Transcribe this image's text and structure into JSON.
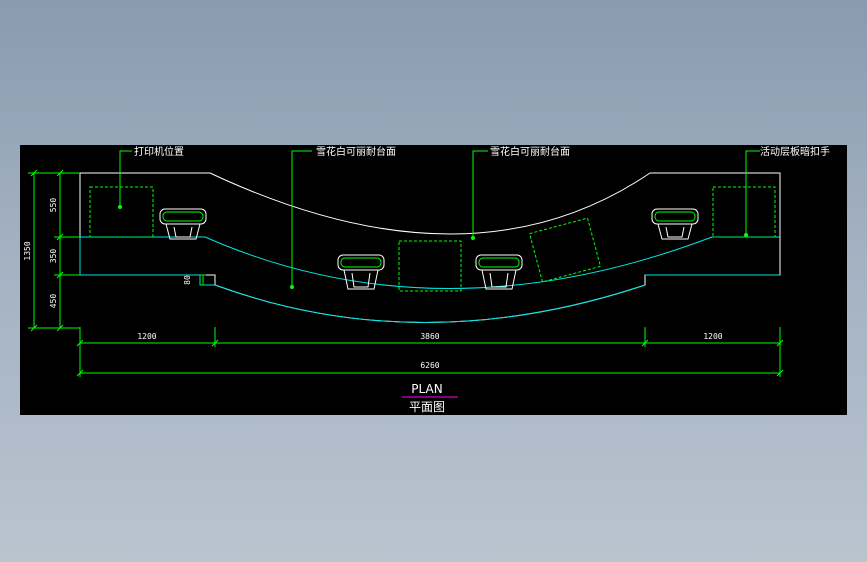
{
  "colors": {
    "background": "#000000",
    "outline": "#ffffff",
    "counter_edge": "#00e5e5",
    "annotation": "#00ff00",
    "title_underline": "#ff00ff"
  },
  "callouts": {
    "printer_position": "打印机位置",
    "marble_top_1": "雪花白可丽耐台面",
    "marble_top_2": "雪花白可丽耐台面",
    "movable_shelf": "活动层板暗扣手"
  },
  "dimensions": {
    "vertical_total": "1350",
    "vertical_top": "550",
    "vertical_mid": "350",
    "vertical_bottom": "450",
    "step": "80",
    "left_width": "1200",
    "center_width": "3860",
    "right_width": "1200",
    "total_width": "6260"
  },
  "title": {
    "english": "PLAN",
    "chinese": "平面图"
  }
}
